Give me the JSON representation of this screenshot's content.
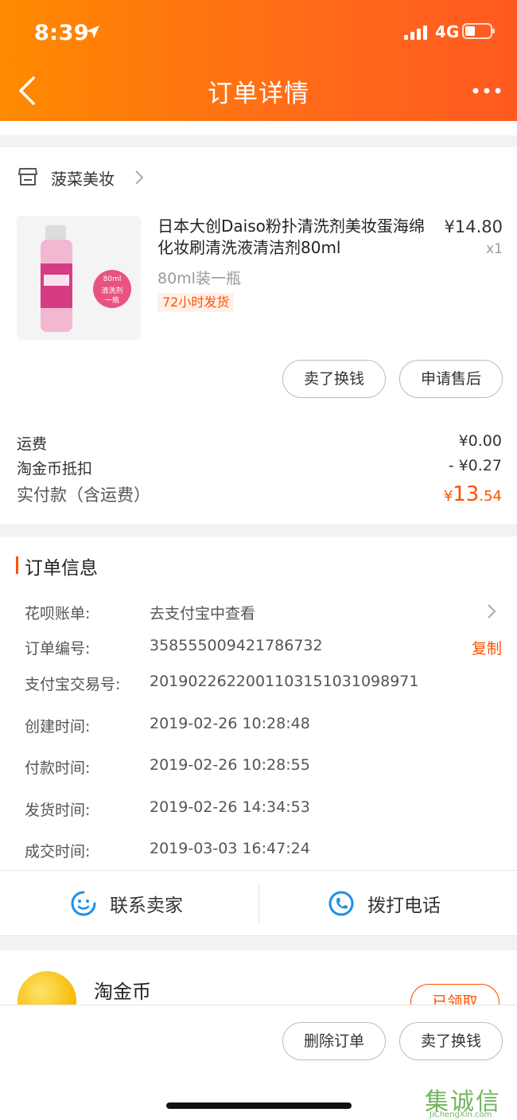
{
  "status_bar": {
    "time": "8:39",
    "network": "4G"
  },
  "nav": {
    "title": "订单详情",
    "back_icon": "chevron-left-icon",
    "more_icon": "more-dots-icon"
  },
  "shop": {
    "name": "菠菜美妆",
    "icon": "store-icon"
  },
  "product": {
    "name": "日本大创Daiso粉扑清洗剂美妆蛋海绵化妆刷清洗液清洁剂80ml",
    "price": "¥14.80",
    "quantity": "x1",
    "spec": "80ml装一瓶",
    "tag": "72小时发货",
    "thumbnail_badge": [
      "80ml",
      "清洗剂",
      "一瓶"
    ]
  },
  "item_actions": {
    "sell": "卖了换钱",
    "after_sale": "申请售后"
  },
  "fees": {
    "shipping_label": "运费",
    "shipping_value": "¥0.00",
    "coin_label": "淘金币抵扣",
    "coin_value": "- ¥0.27",
    "total_label": "实付款（含运费）",
    "total_symbol": "¥",
    "total_int": "13",
    "total_dec": ".54"
  },
  "order_info": {
    "title": "订单信息",
    "huabei_label": "花呗账单:",
    "huabei_value": "去支付宝中查看",
    "order_no_label": "订单编号:",
    "order_no_value": "358555009421786732",
    "copy_label": "复制",
    "alipay_label": "支付宝交易号:",
    "alipay_value": "2019022622001103151031098971",
    "created_label": "创建时间:",
    "created_value": "2019-02-26 10:28:48",
    "paid_label": "付款时间:",
    "paid_value": "2019-02-26 10:28:55",
    "shipped_label": "发货时间:",
    "shipped_value": "2019-02-26 14:34:53",
    "deal_label": "成交时间:",
    "deal_value": "2019-03-03 16:47:24"
  },
  "contact": {
    "seller": "联系卖家",
    "call": "拨打电话"
  },
  "coin": {
    "name": "淘金币",
    "button": "已领取"
  },
  "bottom_actions": {
    "delete": "删除订单",
    "sell": "卖了换钱"
  },
  "watermark": {
    "logo": "集诚信",
    "url": "JiChengXin.com"
  },
  "colors": {
    "accent": "#ff5000",
    "header_start": "#ff8a00",
    "header_end": "#ff5a20"
  }
}
